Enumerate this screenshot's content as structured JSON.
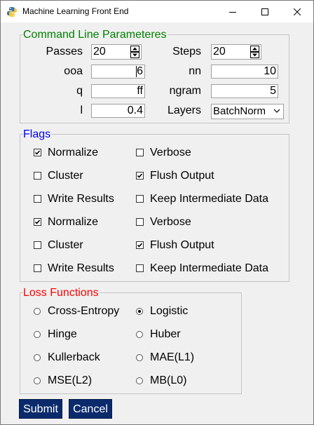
{
  "window": {
    "title": "Machine Learning Front End",
    "controls": {
      "minimize_icon": "minimize-icon",
      "maximize_icon": "maximize-icon",
      "close_icon": "close-icon"
    }
  },
  "params": {
    "legend": "Command Line Parameteres",
    "color": "#008000",
    "passes": {
      "label": "Passes",
      "value": "20"
    },
    "steps": {
      "label": "Steps",
      "value": "20"
    },
    "ooa": {
      "label": "ooa",
      "value": "6"
    },
    "nn": {
      "label": "nn",
      "value": "10"
    },
    "q": {
      "label": "q",
      "value": "ff"
    },
    "ngram": {
      "label": "ngram",
      "value": "5"
    },
    "l": {
      "label": "l",
      "value": "0.4"
    },
    "layers": {
      "label": "Layers",
      "value": "BatchNorm"
    }
  },
  "flags": {
    "legend": "Flags",
    "color": "#0000ff",
    "items": [
      {
        "label": "Normalize",
        "checked": true
      },
      {
        "label": "Verbose",
        "checked": false
      },
      {
        "label": "Cluster",
        "checked": false
      },
      {
        "label": "Flush Output",
        "checked": true
      },
      {
        "label": "Write Results",
        "checked": false
      },
      {
        "label": "Keep Intermediate Data",
        "checked": false
      },
      {
        "label": "Normalize",
        "checked": true
      },
      {
        "label": "Verbose",
        "checked": false
      },
      {
        "label": "Cluster",
        "checked": false
      },
      {
        "label": "Flush Output",
        "checked": true
      },
      {
        "label": "Write Results",
        "checked": false
      },
      {
        "label": "Keep Intermediate Data",
        "checked": false
      }
    ]
  },
  "loss": {
    "legend": "Loss Functions",
    "color": "#ff0000",
    "items": [
      {
        "label": "Cross-Entropy",
        "selected": false
      },
      {
        "label": "Logistic",
        "selected": true
      },
      {
        "label": "Hinge",
        "selected": false
      },
      {
        "label": "Huber",
        "selected": false
      },
      {
        "label": "Kullerback",
        "selected": false
      },
      {
        "label": "MAE(L1)",
        "selected": false
      },
      {
        "label": "MSE(L2)",
        "selected": false
      },
      {
        "label": "MB(L0)",
        "selected": false
      }
    ]
  },
  "buttons": {
    "submit": "Submit",
    "cancel": "Cancel",
    "color": "#0a2a6b"
  }
}
